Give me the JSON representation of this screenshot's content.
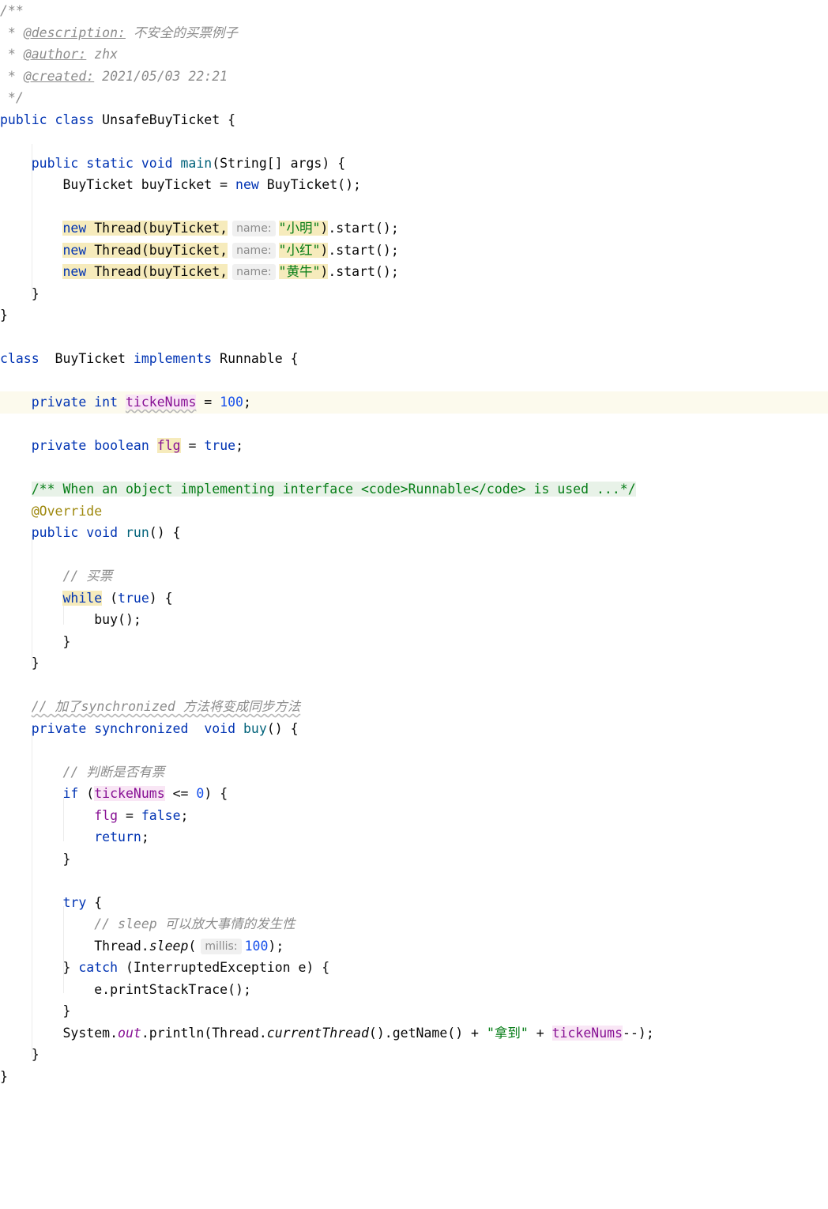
{
  "editor": {
    "language": "java",
    "lines": [
      {
        "tokens": [
          {
            "t": "/**",
            "c": "cmt"
          }
        ]
      },
      {
        "tokens": [
          {
            "t": " * ",
            "c": "cmt"
          },
          {
            "t": "@description:",
            "c": "doctag"
          },
          {
            "t": " 不安全的买票例子",
            "c": "cmt"
          }
        ]
      },
      {
        "tokens": [
          {
            "t": " * ",
            "c": "cmt"
          },
          {
            "t": "@author:",
            "c": "doctag"
          },
          {
            "t": " zhx",
            "c": "cmt"
          }
        ]
      },
      {
        "tokens": [
          {
            "t": " * ",
            "c": "cmt"
          },
          {
            "t": "@created:",
            "c": "doctag"
          },
          {
            "t": " 2021/05/03 22:21",
            "c": "cmt"
          }
        ]
      },
      {
        "tokens": [
          {
            "t": " */",
            "c": "cmt"
          }
        ]
      },
      {
        "tokens": [
          {
            "t": "public class",
            "c": "kw"
          },
          {
            "t": " UnsafeBuyTicket {"
          }
        ]
      },
      {
        "tokens": []
      },
      {
        "tokens": [
          {
            "t": "    "
          },
          {
            "t": "public static void",
            "c": "kw"
          },
          {
            "t": " "
          },
          {
            "t": "main",
            "c": "method"
          },
          {
            "t": "(String[] args) {"
          }
        ]
      },
      {
        "tokens": [
          {
            "t": "        BuyTicket buyTicket = "
          },
          {
            "t": "new",
            "c": "kw"
          },
          {
            "t": " BuyTicket();"
          }
        ]
      },
      {
        "tokens": []
      },
      {
        "tokens": [
          {
            "t": "        "
          },
          {
            "t": "new",
            "c": "kw hl-y"
          },
          {
            "t": " Thread(buyTicket,",
            "c": "hl-y"
          },
          {
            "t": "name:",
            "c": "hint"
          },
          {
            "t": "\"小明\"",
            "c": "str hl-y"
          },
          {
            "t": ")",
            "c": "hl-y"
          },
          {
            "t": ".start();"
          }
        ]
      },
      {
        "tokens": [
          {
            "t": "        "
          },
          {
            "t": "new",
            "c": "kw hl-y"
          },
          {
            "t": " Thread(buyTicket,",
            "c": "hl-y"
          },
          {
            "t": "name:",
            "c": "hint"
          },
          {
            "t": "\"小红\"",
            "c": "str hl-y"
          },
          {
            "t": ")",
            "c": "hl-y"
          },
          {
            "t": ".start();"
          }
        ]
      },
      {
        "tokens": [
          {
            "t": "        "
          },
          {
            "t": "new",
            "c": "kw hl-y"
          },
          {
            "t": " Thread(buyTicket,",
            "c": "hl-y"
          },
          {
            "t": "name:",
            "c": "hint"
          },
          {
            "t": "\"黄牛\"",
            "c": "str hl-y"
          },
          {
            "t": ")",
            "c": "hl-y"
          },
          {
            "t": ".start();"
          }
        ]
      },
      {
        "tokens": [
          {
            "t": "    }"
          }
        ]
      },
      {
        "tokens": [
          {
            "t": "}"
          }
        ]
      },
      {
        "tokens": []
      },
      {
        "tokens": [
          {
            "t": "class",
            "c": "kw"
          },
          {
            "t": "  BuyTicket "
          },
          {
            "t": "implements",
            "c": "kw"
          },
          {
            "t": " Runnable {"
          }
        ]
      },
      {
        "tokens": []
      },
      {
        "current": true,
        "tokens": [
          {
            "t": "    "
          },
          {
            "t": "private int",
            "c": "kw"
          },
          {
            "t": " "
          },
          {
            "t": "tickeNums",
            "c": "field hl-p wavy"
          },
          {
            "t": " = "
          },
          {
            "t": "100",
            "c": "num"
          },
          {
            "t": ";"
          }
        ]
      },
      {
        "tokens": []
      },
      {
        "tokens": [
          {
            "t": "    "
          },
          {
            "t": "private boolean",
            "c": "kw"
          },
          {
            "t": " "
          },
          {
            "t": "flg",
            "c": "field hl-y"
          },
          {
            "t": " = "
          },
          {
            "t": "true",
            "c": "kw"
          },
          {
            "t": ";"
          }
        ]
      },
      {
        "tokens": []
      },
      {
        "tokens": [
          {
            "t": "    "
          },
          {
            "t": "/** When an object implementing interface <code>Runnable</code> is used ...*/",
            "c": "docblock"
          }
        ]
      },
      {
        "tokens": [
          {
            "t": "    "
          },
          {
            "t": "@Override",
            "c": "annot"
          }
        ]
      },
      {
        "tokens": [
          {
            "t": "    "
          },
          {
            "t": "public void",
            "c": "kw"
          },
          {
            "t": " "
          },
          {
            "t": "run",
            "c": "method"
          },
          {
            "t": "() {"
          }
        ]
      },
      {
        "tokens": []
      },
      {
        "tokens": [
          {
            "t": "        "
          },
          {
            "t": "// 买票",
            "c": "cmt"
          }
        ]
      },
      {
        "tokens": [
          {
            "t": "        "
          },
          {
            "t": "while",
            "c": "kw hl-y"
          },
          {
            "t": " ("
          },
          {
            "t": "true",
            "c": "kw"
          },
          {
            "t": ") {"
          }
        ]
      },
      {
        "tokens": [
          {
            "t": "            buy();"
          }
        ]
      },
      {
        "tokens": [
          {
            "t": "        }"
          }
        ]
      },
      {
        "tokens": [
          {
            "t": "    }"
          }
        ]
      },
      {
        "tokens": []
      },
      {
        "tokens": [
          {
            "t": "    "
          },
          {
            "t": "// 加了synchronized 方法将变成同步方法",
            "c": "cmt wavy"
          }
        ]
      },
      {
        "tokens": [
          {
            "t": "    "
          },
          {
            "t": "private synchronized",
            "c": "kw"
          },
          {
            "t": "  "
          },
          {
            "t": "void",
            "c": "kw"
          },
          {
            "t": " "
          },
          {
            "t": "buy",
            "c": "method"
          },
          {
            "t": "() {"
          }
        ]
      },
      {
        "tokens": []
      },
      {
        "tokens": [
          {
            "t": "        "
          },
          {
            "t": "// 判断是否有票",
            "c": "cmt"
          }
        ]
      },
      {
        "tokens": [
          {
            "t": "        "
          },
          {
            "t": "if",
            "c": "kw"
          },
          {
            "t": " ("
          },
          {
            "t": "tickeNums",
            "c": "field hl-p"
          },
          {
            "t": " <= "
          },
          {
            "t": "0",
            "c": "num"
          },
          {
            "t": ") {"
          }
        ]
      },
      {
        "tokens": [
          {
            "t": "            "
          },
          {
            "t": "flg",
            "c": "field"
          },
          {
            "t": " = "
          },
          {
            "t": "false",
            "c": "kw"
          },
          {
            "t": ";"
          }
        ]
      },
      {
        "tokens": [
          {
            "t": "            "
          },
          {
            "t": "return",
            "c": "kw"
          },
          {
            "t": ";"
          }
        ]
      },
      {
        "tokens": [
          {
            "t": "        }"
          }
        ]
      },
      {
        "tokens": []
      },
      {
        "tokens": [
          {
            "t": "        "
          },
          {
            "t": "try",
            "c": "kw"
          },
          {
            "t": " {"
          }
        ]
      },
      {
        "tokens": [
          {
            "t": "            "
          },
          {
            "t": "// sleep 可以放大事情的发生性",
            "c": "cmt"
          }
        ]
      },
      {
        "tokens": [
          {
            "t": "            Thread."
          },
          {
            "t": "sleep",
            "c": "static-call"
          },
          {
            "t": "("
          },
          {
            "t": "millis:",
            "c": "hint"
          },
          {
            "t": "100",
            "c": "num"
          },
          {
            "t": ");"
          }
        ]
      },
      {
        "tokens": [
          {
            "t": "        } "
          },
          {
            "t": "catch",
            "c": "kw"
          },
          {
            "t": " (InterruptedException e) {"
          }
        ]
      },
      {
        "tokens": [
          {
            "t": "            e.printStackTrace();"
          }
        ]
      },
      {
        "tokens": [
          {
            "t": "        }"
          }
        ]
      },
      {
        "tokens": [
          {
            "t": "        System."
          },
          {
            "t": "out",
            "c": "static-field"
          },
          {
            "t": ".println(Thread."
          },
          {
            "t": "currentThread",
            "c": "static-call"
          },
          {
            "t": "().getName() + "
          },
          {
            "t": "\"拿到\"",
            "c": "str"
          },
          {
            "t": " + "
          },
          {
            "t": "tickeNums",
            "c": "field hl-p"
          },
          {
            "t": "--);"
          }
        ]
      },
      {
        "tokens": [
          {
            "t": "    }"
          }
        ]
      },
      {
        "tokens": [
          {
            "t": "}"
          }
        ]
      }
    ]
  }
}
